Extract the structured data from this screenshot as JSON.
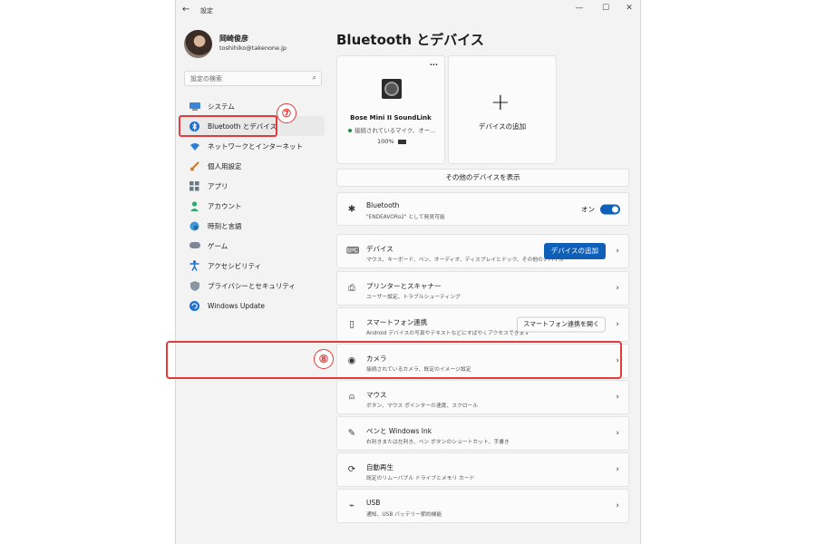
{
  "window": {
    "title": "設定",
    "back": "←",
    "minimize": "—",
    "maximize": "☐",
    "close": "✕"
  },
  "user": {
    "name": "岡崎俊彦",
    "email": "toshihiko@takenone.jp"
  },
  "search": {
    "placeholder": "設定の検索"
  },
  "sidebar": {
    "items": [
      {
        "label": "システム"
      },
      {
        "label": "Bluetooth とデバイス"
      },
      {
        "label": "ネットワークとインターネット"
      },
      {
        "label": "個人用設定"
      },
      {
        "label": "アプリ"
      },
      {
        "label": "アカウント"
      },
      {
        "label": "時刻と言語"
      },
      {
        "label": "ゲーム"
      },
      {
        "label": "アクセシビリティ"
      },
      {
        "label": "プライバシーとセキュリティ"
      },
      {
        "label": "Windows Update"
      }
    ]
  },
  "annotations": {
    "seven": "⑦",
    "eight": "⑧"
  },
  "main": {
    "title": "Bluetooth とデバイス",
    "device_card": {
      "name": "Bose Mini II SoundLink",
      "status": "接続されているマイク、オー...",
      "battery": "100%",
      "menu": "···"
    },
    "add_card": {
      "label": "デバイスの追加",
      "plus": "+"
    },
    "show_more": "その他のデバイスを表示",
    "bluetooth": {
      "title": "Bluetooth",
      "sub": "\"ENDEAVORo2\" として発見可能",
      "toggle_label": "オン"
    },
    "rows": [
      {
        "title": "デバイス",
        "sub": "マウス、キーボード、ペン、オーディオ、ディスプレイとドック、その他のデバイス",
        "button": "デバイスの追加"
      },
      {
        "title": "プリンターとスキャナー",
        "sub": "ユーザー設定、トラブルシューティング"
      },
      {
        "title": "スマートフォン連携",
        "sub": "Android デバイスの写真やテキストなどにすばやくアクセスできます",
        "button": "スマートフォン連携を開く"
      },
      {
        "title": "カメラ",
        "sub": "接続されているカメラ、既定のイメージ設定"
      },
      {
        "title": "マウス",
        "sub": "ボタン、マウス ポインターの速度、スクロール"
      },
      {
        "title": "ペンと Windows Ink",
        "sub": "右利きまたは左利き、ペン ボタンのショートカット、手書き"
      },
      {
        "title": "自動再生",
        "sub": "既定のリムーバブル ドライブとメモリ カード"
      },
      {
        "title": "USB",
        "sub": "通知、USB バッテリー節約機能"
      }
    ]
  },
  "colors": {
    "accent": "#0f5fb8",
    "annotation": "#e23b3b"
  }
}
